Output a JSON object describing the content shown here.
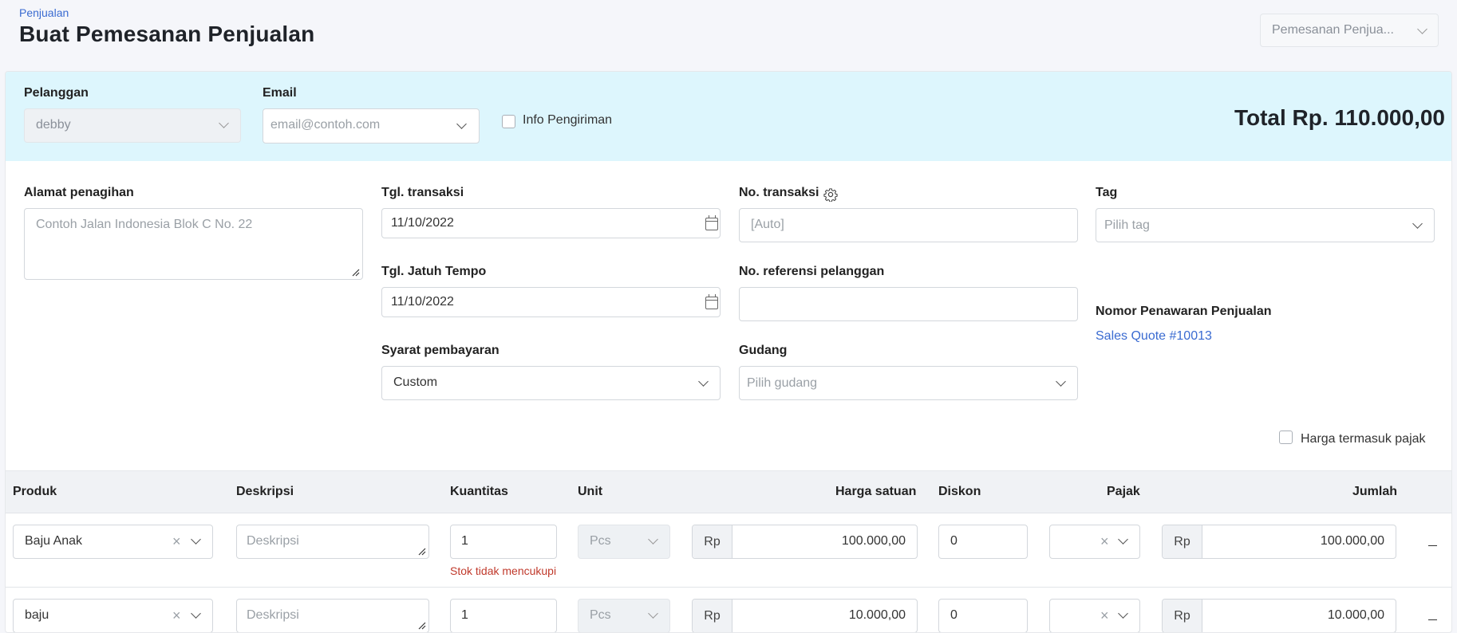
{
  "header": {
    "breadcrumb": "Penjualan",
    "title": "Buat Pemesanan Penjualan",
    "type_select": "Pemesanan Penjua..."
  },
  "banner": {
    "customer_label": "Pelanggan",
    "customer_value": "debby",
    "email_label": "Email",
    "email_placeholder": "email@contoh.com",
    "shipping_info_label": "Info Pengiriman",
    "total": "Total Rp. 110.000,00"
  },
  "form": {
    "billing_address_label": "Alamat penagihan",
    "billing_address_placeholder": "Contoh Jalan Indonesia Blok C No. 22",
    "transaction_date_label": "Tgl. transaksi",
    "transaction_date_value": "11/10/2022",
    "due_date_label": "Tgl. Jatuh Tempo",
    "due_date_value": "11/10/2022",
    "payment_terms_label": "Syarat pembayaran",
    "payment_terms_value": "Custom",
    "transaction_no_label": "No. transaksi",
    "transaction_no_placeholder": "[Auto]",
    "customer_ref_label": "No. referensi pelanggan",
    "customer_ref_value": "",
    "warehouse_label": "Gudang",
    "warehouse_placeholder": "Pilih gudang",
    "tag_label": "Tag",
    "tag_placeholder": "Pilih tag",
    "quote_no_label": "Nomor Penawaran Penjualan",
    "quote_link": "Sales Quote #10013",
    "tax_inclusive_label": "Harga termasuk pajak"
  },
  "table": {
    "headers": {
      "product": "Produk",
      "description": "Deskripsi",
      "quantity": "Kuantitas",
      "unit": "Unit",
      "unit_price": "Harga satuan",
      "discount": "Diskon",
      "tax": "Pajak",
      "amount": "Jumlah"
    },
    "rows": [
      {
        "product": "Baju Anak",
        "description_placeholder": "Deskripsi",
        "quantity": "1",
        "unit": "Pcs",
        "currency": "Rp",
        "unit_price": "100.000,00",
        "discount": "0",
        "amount": "100.000,00",
        "warning": "Stok tidak mencukupi"
      },
      {
        "product": "baju",
        "description_placeholder": "Deskripsi",
        "quantity": "1",
        "unit": "Pcs",
        "currency": "Rp",
        "unit_price": "10.000,00",
        "discount": "0",
        "amount": "10.000,00"
      }
    ]
  }
}
